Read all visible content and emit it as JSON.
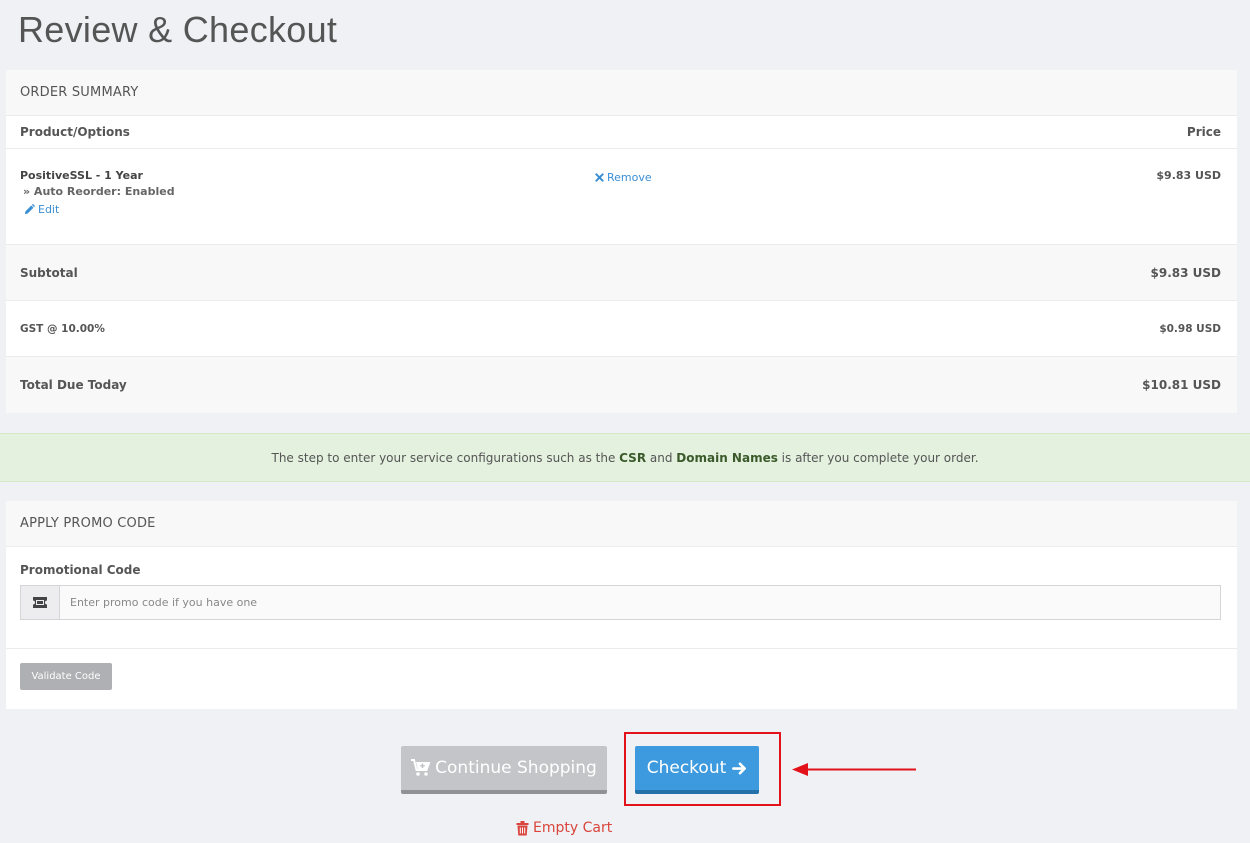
{
  "page": {
    "title": "Review & Checkout"
  },
  "order_summary": {
    "heading": "ORDER SUMMARY",
    "col_product": "Product/Options",
    "col_price": "Price",
    "item": {
      "name": "PositiveSSL - 1 Year",
      "option": "» Auto Reorder: Enabled",
      "edit_label": "Edit",
      "remove_label": "Remove",
      "price": "$9.83 USD"
    },
    "subtotal_label": "Subtotal",
    "subtotal_value": "$9.83 USD",
    "tax_label": "GST @ 10.00%",
    "tax_value": "$0.98 USD",
    "total_label": "Total Due Today",
    "total_value": "$10.81 USD"
  },
  "notice": {
    "pre": "The step to enter your service configurations such as the ",
    "csr": "CSR",
    "mid": " and ",
    "domains": "Domain Names",
    "post": " is after you complete your order."
  },
  "promo": {
    "heading": "APPLY PROMO CODE",
    "label": "Promotional Code",
    "placeholder": "Enter promo code if you have one",
    "value": "",
    "validate_label": "Validate Code"
  },
  "actions": {
    "continue_label": "Continue Shopping",
    "checkout_label": "Checkout",
    "empty_cart_label": "Empty Cart"
  },
  "annotation": {
    "highlight_color": "#e2111a"
  },
  "icons": {
    "edit": "pencil-icon",
    "remove": "times-icon",
    "promo": "ticket-icon",
    "continue": "cart-plus-icon",
    "checkout": "arrow-right-icon",
    "empty": "trash-icon"
  },
  "colors": {
    "primary": "#3e9ade",
    "link": "#3a8ed4",
    "danger": "#d9453c",
    "success_bg": "#e4f1df"
  }
}
